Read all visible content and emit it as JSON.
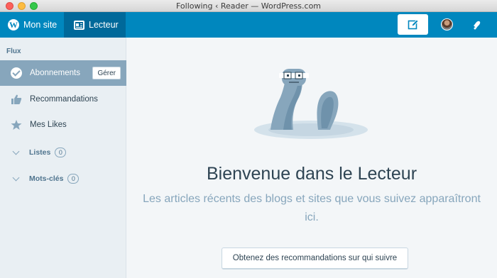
{
  "window": {
    "title": "Following ‹ Reader — WordPress.com"
  },
  "masterbar": {
    "my_site_label": "Mon site",
    "reader_label": "Lecteur",
    "icons": [
      "wordpress-logo-icon",
      "reader-icon",
      "write-icon",
      "avatar",
      "notifications-icon"
    ],
    "accent_color": "#0087be"
  },
  "sidebar": {
    "heading": "Flux",
    "items": [
      {
        "label": "Abonnements",
        "icon": "checkmark-icon",
        "action": "Gérer",
        "active": true
      },
      {
        "label": "Recommandations",
        "icon": "thumbs-up-icon"
      },
      {
        "label": "Mes Likes",
        "icon": "star-icon"
      }
    ],
    "lists": {
      "label": "Listes",
      "count": "0"
    },
    "tags": {
      "label": "Mots-clés",
      "count": "0"
    }
  },
  "main": {
    "title": "Bienvenue dans le Lecteur",
    "subtitle": "Les articles récents des blogs et sites que vous suivez apparaîtront ici.",
    "button_label": "Obtenez des recommandations sur qui suivre"
  }
}
